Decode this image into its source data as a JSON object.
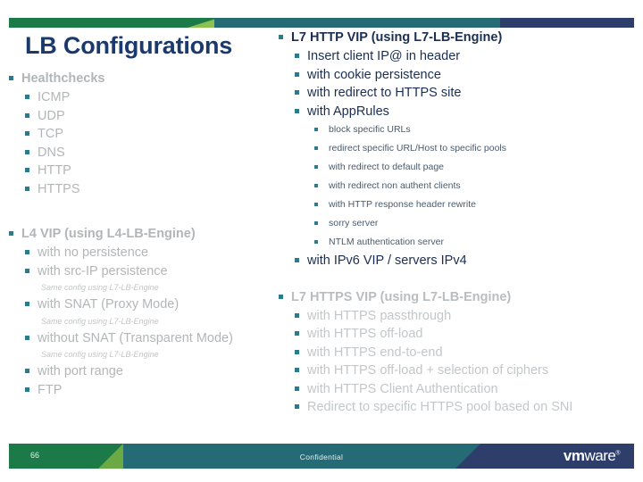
{
  "slide": {
    "title": "LB Configurations"
  },
  "left_column": {
    "groups": [
      {
        "heading": "Healthchecks",
        "items": [
          {
            "label": "ICMP"
          },
          {
            "label": "UDP"
          },
          {
            "label": "TCP"
          },
          {
            "label": "DNS"
          },
          {
            "label": "HTTP"
          },
          {
            "label": "HTTPS"
          }
        ]
      },
      {
        "heading": "L4 VIP (using L4-LB-Engine)",
        "items": [
          {
            "label": "with no persistence"
          },
          {
            "label": "with src-IP persistence"
          },
          {
            "note": "Same config using L7-LB-Engine"
          },
          {
            "label": "with SNAT (Proxy Mode)"
          },
          {
            "note": "Same config using L7-LB-Engine"
          },
          {
            "label": "without SNAT (Transparent Mode)"
          },
          {
            "note": "Same config using L7-LB-Engine"
          },
          {
            "label": "with port range"
          },
          {
            "label": "FTP"
          }
        ]
      }
    ]
  },
  "right_column": {
    "groups": [
      {
        "heading": "L7 HTTP VIP (using L7-LB-Engine)",
        "items": [
          {
            "label": "Insert client IP@ in header"
          },
          {
            "label": "with cookie persistence"
          },
          {
            "label": "with redirect to HTTPS site"
          },
          {
            "label": "with AppRules"
          }
        ],
        "subitems": [
          {
            "label": "block specific URLs"
          },
          {
            "label": "redirect specific URL/Host to specific pools"
          },
          {
            "label": "with redirect to default page"
          },
          {
            "label": "with redirect non authent clients"
          },
          {
            "label": "with HTTP response header rewrite"
          },
          {
            "label": "sorry server"
          },
          {
            "label": "NTLM authentication server"
          }
        ],
        "trailing": [
          {
            "label": "with IPv6 VIP / servers IPv4"
          }
        ]
      },
      {
        "heading": "L7 HTTPS VIP (using L7-LB-Engine)",
        "items": [
          {
            "label": "with HTTPS passthrough"
          },
          {
            "label": "with HTTPS off-load"
          },
          {
            "label": "with HTTPS end-to-end"
          },
          {
            "label": "with HTTPS off-load + selection of ciphers"
          },
          {
            "label": "with HTTPS Client Authentication"
          },
          {
            "label": "Redirect to specific HTTPS pool based on SNI"
          }
        ]
      }
    ]
  },
  "footer": {
    "page_number": "66",
    "confidential": "Confidential",
    "logo_vm": "vm",
    "logo_ware": "ware",
    "logo_tm": "®"
  },
  "colors": {
    "title_navy": "#1b3a6b",
    "body_navy": "#1b2f52",
    "muted_grey": "#b3b6b8",
    "bullet_teal": "#2c7a8c",
    "bar_green": "#1b7a47",
    "bar_light_green": "#8cc152",
    "bar_teal": "#246b76",
    "bar_navy": "#2d3e6b"
  }
}
